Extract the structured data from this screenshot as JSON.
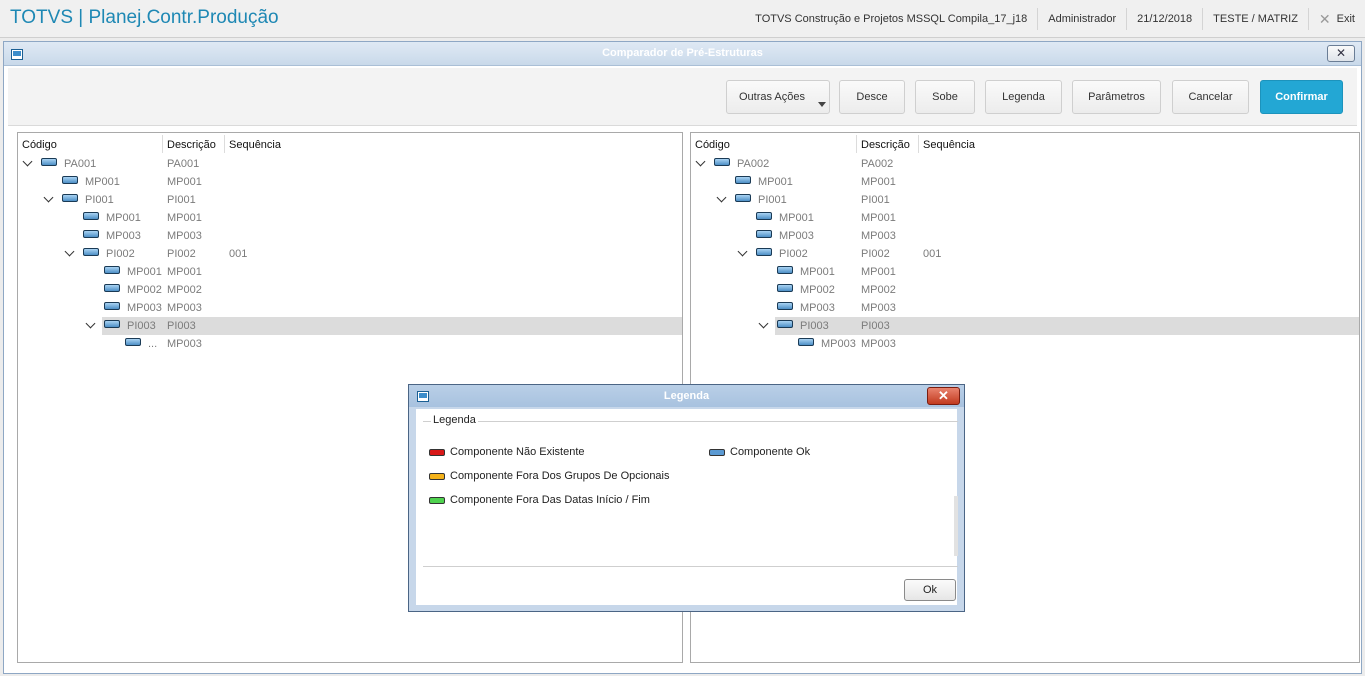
{
  "app": {
    "title": "TOTVS | Planej.Contr.Produção",
    "environment": "TOTVS Construção e Projetos MSSQL Compila_17_j18",
    "user": "Administrador",
    "date": "21/12/2018",
    "company": "TESTE / MATRIZ",
    "exit_label": "Exit"
  },
  "dialog": {
    "title": "Comparador de Pré-Estruturas",
    "close_glyph": "✕"
  },
  "toolbar": {
    "outras_acoes": "Outras Ações",
    "desce": "Desce",
    "sobe": "Sobe",
    "legenda": "Legenda",
    "parametros": "Parâmetros",
    "cancelar": "Cancelar",
    "confirmar": "Confirmar"
  },
  "columns": {
    "codigo": "Código",
    "descricao": "Descrição",
    "sequencia": "Sequência"
  },
  "left_tree": [
    {
      "code": "PA001",
      "desc": "PA001",
      "seq": "",
      "level": 0,
      "expanded": true
    },
    {
      "code": "MP001",
      "desc": "MP001",
      "seq": "",
      "level": 1
    },
    {
      "code": "PI001",
      "desc": "PI001",
      "seq": "",
      "level": 1,
      "expanded": true
    },
    {
      "code": "MP001",
      "desc": "MP001",
      "seq": "",
      "level": 2
    },
    {
      "code": "MP003",
      "desc": "MP003",
      "seq": "",
      "level": 2
    },
    {
      "code": "PI002",
      "desc": "PI002",
      "seq": "001",
      "level": 2,
      "expanded": true
    },
    {
      "code": "MP001",
      "desc": "MP001",
      "seq": "",
      "level": 3
    },
    {
      "code": "MP002",
      "desc": "MP002",
      "seq": "",
      "level": 3
    },
    {
      "code": "MP003",
      "desc": "MP003",
      "seq": "",
      "level": 3
    },
    {
      "code": "PI003",
      "desc": "PI003",
      "seq": "",
      "level": 3,
      "expanded": true,
      "selected": true
    },
    {
      "code": "...",
      "desc": "MP003",
      "seq": "",
      "level": 4
    }
  ],
  "right_tree": [
    {
      "code": "PA002",
      "desc": "PA002",
      "seq": "",
      "level": 0,
      "expanded": true
    },
    {
      "code": "MP001",
      "desc": "MP001",
      "seq": "",
      "level": 1
    },
    {
      "code": "PI001",
      "desc": "PI001",
      "seq": "",
      "level": 1,
      "expanded": true
    },
    {
      "code": "MP001",
      "desc": "MP001",
      "seq": "",
      "level": 2
    },
    {
      "code": "MP003",
      "desc": "MP003",
      "seq": "",
      "level": 2
    },
    {
      "code": "PI002",
      "desc": "PI002",
      "seq": "001",
      "level": 2,
      "expanded": true
    },
    {
      "code": "MP001",
      "desc": "MP001",
      "seq": "",
      "level": 3
    },
    {
      "code": "MP002",
      "desc": "MP002",
      "seq": "",
      "level": 3
    },
    {
      "code": "MP003",
      "desc": "MP003",
      "seq": "",
      "level": 3
    },
    {
      "code": "PI003",
      "desc": "PI003",
      "seq": "",
      "level": 3,
      "expanded": true,
      "selected": true
    },
    {
      "code": "MP003",
      "desc": "MP003",
      "seq": "",
      "level": 4
    }
  ],
  "legend": {
    "title": "Legenda",
    "group_label": "Legenda",
    "close_glyph": "✕",
    "items": [
      {
        "label": "Componente Não Existente",
        "color": "#d81818"
      },
      {
        "label": "Componente Fora Dos Grupos De Opcionais",
        "color": "#f4b21a"
      },
      {
        "label": "Componente Fora Das Datas Início / Fim",
        "color": "#4fd24f"
      },
      {
        "label": "Componente Ok",
        "color": "#5b9ad3"
      }
    ],
    "ok_label": "Ok"
  },
  "colors": {
    "accent": "#23a7d4",
    "app_title": "#1e88b4",
    "selected_row": "#dcdcdc"
  }
}
